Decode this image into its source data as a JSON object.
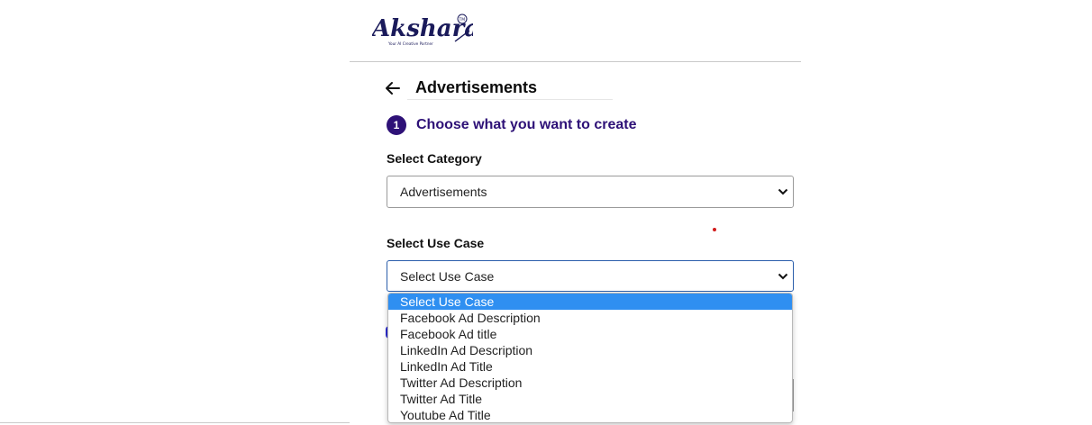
{
  "brand": {
    "name": "Akshara",
    "tagline": "Your AI Creative Partner",
    "trademark": "TM",
    "color": "#1a1a5a"
  },
  "header": {
    "back_icon": "arrow-left-icon",
    "title": "Advertisements"
  },
  "step": {
    "number": "1",
    "title": "Choose what you want to create",
    "color": "#2e1177"
  },
  "category": {
    "label": "Select Category",
    "value": "Advertisements"
  },
  "use_case": {
    "label": "Select Use Case",
    "value": "Select Use Case",
    "options": [
      "Select Use Case",
      "Facebook Ad Description",
      "Facebook Ad title",
      "LinkedIn Ad Description",
      "LinkedIn Ad Title",
      "Twitter Ad Description",
      "Twitter Ad Title",
      "Youtube Ad Title"
    ],
    "highlighted_color": "#2f8ff1"
  }
}
